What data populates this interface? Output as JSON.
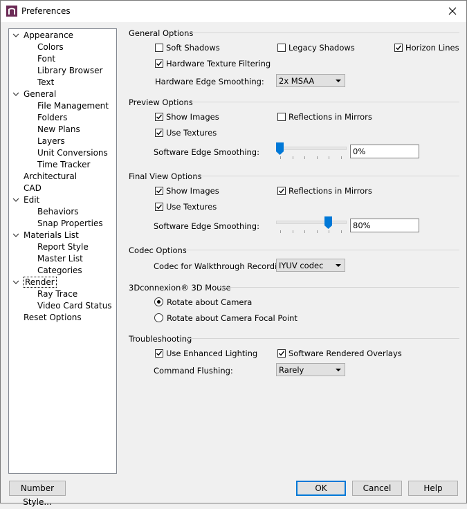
{
  "window": {
    "title": "Preferences",
    "close_icon": "close-icon",
    "app_icon": "app-logo-icon"
  },
  "tree": {
    "items": [
      {
        "label": "Appearance",
        "expanded": true
      },
      {
        "label": "Colors"
      },
      {
        "label": "Font"
      },
      {
        "label": "Library Browser"
      },
      {
        "label": "Text"
      },
      {
        "label": "General",
        "expanded": true
      },
      {
        "label": "File Management"
      },
      {
        "label": "Folders"
      },
      {
        "label": "New Plans"
      },
      {
        "label": "Layers"
      },
      {
        "label": "Unit Conversions"
      },
      {
        "label": "Time Tracker"
      },
      {
        "label": "Architectural"
      },
      {
        "label": "CAD"
      },
      {
        "label": "Edit",
        "expanded": true
      },
      {
        "label": "Behaviors"
      },
      {
        "label": "Snap Properties"
      },
      {
        "label": "Materials List",
        "expanded": true
      },
      {
        "label": "Report Style"
      },
      {
        "label": "Master List"
      },
      {
        "label": "Categories"
      },
      {
        "label": "Render",
        "expanded": true,
        "selected": true
      },
      {
        "label": "Ray Trace"
      },
      {
        "label": "Video Card Status"
      },
      {
        "label": "Reset Options"
      }
    ]
  },
  "general_options": {
    "header": "General Options",
    "soft_shadows": {
      "label": "Soft Shadows",
      "checked": false
    },
    "legacy_shadows": {
      "label": "Legacy Shadows",
      "checked": false
    },
    "horizon_lines": {
      "label": "Horizon Lines",
      "checked": true
    },
    "hw_texture_filtering": {
      "label": "Hardware Texture Filtering",
      "checked": true
    },
    "hw_edge_smoothing_label": "Hardware Edge Smoothing:",
    "hw_edge_smoothing_value": "2x MSAA"
  },
  "preview_options": {
    "header": "Preview Options",
    "show_images": {
      "label": "Show Images",
      "checked": true
    },
    "reflections": {
      "label": "Reflections in Mirrors",
      "checked": false
    },
    "use_textures": {
      "label": "Use Textures",
      "checked": true
    },
    "sw_edge_label": "Software Edge Smoothing:",
    "sw_edge_value": "0%",
    "slider_level": 0
  },
  "final_view_options": {
    "header": "Final View Options",
    "show_images": {
      "label": "Show Images",
      "checked": true
    },
    "reflections": {
      "label": "Reflections in Mirrors",
      "checked": true
    },
    "use_textures": {
      "label": "Use Textures",
      "checked": true
    },
    "sw_edge_label": "Software Edge Smoothing:",
    "sw_edge_value": "80%",
    "slider_level": 0.8
  },
  "codec_options": {
    "header": "Codec Options",
    "label": "Codec for Walkthrough Recordings:",
    "value": "IYUV codec"
  },
  "mouse_3d": {
    "header": "3Dconnexion® 3D Mouse",
    "rotate_camera": {
      "label": "Rotate about Camera",
      "selected": true
    },
    "rotate_focal": {
      "label": "Rotate about Camera Focal Point",
      "selected": false
    }
  },
  "troubleshooting": {
    "header": "Troubleshooting",
    "enhanced_lighting": {
      "label": "Use Enhanced Lighting",
      "checked": true
    },
    "sw_overlays": {
      "label": "Software Rendered Overlays",
      "checked": true
    },
    "flushing_label": "Command Flushing:",
    "flushing_value": "Rarely"
  },
  "buttons": {
    "number_style": "Number Style...",
    "ok": "OK",
    "cancel": "Cancel",
    "help": "Help"
  },
  "colors": {
    "accent": "#0078d7",
    "slider_thumb": "#0078d7"
  }
}
